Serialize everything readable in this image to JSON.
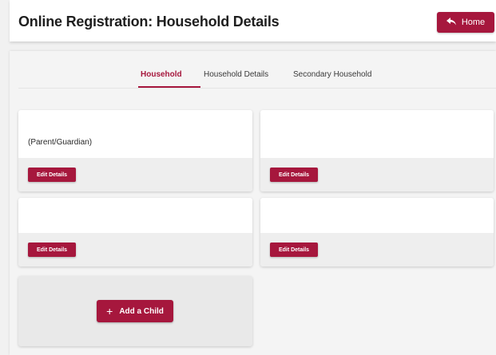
{
  "header": {
    "title": "Online Registration: Household Details",
    "home_label": "Home",
    "home_icon": "reply-arrow-icon"
  },
  "tabs": [
    {
      "label": "Household",
      "active": true
    },
    {
      "label": "Household Details",
      "active": false
    },
    {
      "label": "Secondary Household",
      "active": false
    }
  ],
  "cards": [
    {
      "text": "(Parent/Guardian)",
      "button_label": "Edit Details"
    },
    {
      "text": "",
      "button_label": "Edit Details"
    },
    {
      "text": "",
      "button_label": "Edit Details"
    },
    {
      "text": "",
      "button_label": "Edit Details"
    }
  ],
  "add_child": {
    "label": "Add a Child",
    "icon": "plus-icon"
  },
  "colors": {
    "accent": "#a6173d",
    "background": "#f1f1f1",
    "card_footer": "#eeeeee"
  }
}
